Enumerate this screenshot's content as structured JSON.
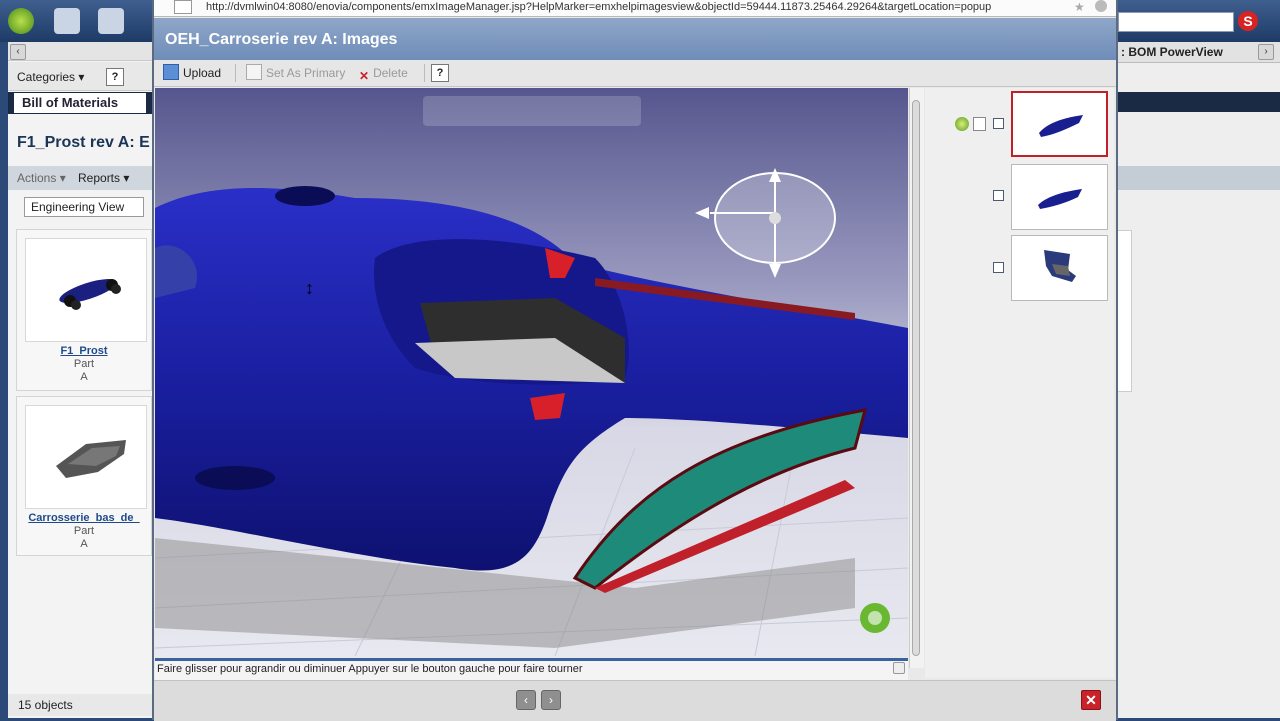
{
  "browser": {
    "url": "http://dvmlwin04:8080/enovia/components/emxImageManager.jsp?HelpMarker=emxhelpimagesview&objectId=59444.11873.25464.29264&targetLocation=popup"
  },
  "background_app": {
    "categories_label": "Categories",
    "help_label": "?",
    "tab_label": "Bill of Materials",
    "page_title": "F1_Prost rev A: E",
    "actions_label": "Actions",
    "reports_label": "Reports",
    "view_select": "Engineering View",
    "right_header": ": BOM PowerView",
    "cards": [
      {
        "name": "F1_Prost",
        "type": "Part",
        "rev": "A"
      },
      {
        "name": "Carrosserie_bas_de_",
        "type": "Part",
        "rev": "A"
      }
    ],
    "object_count": "15 objects"
  },
  "popup": {
    "title": "OEH_Carroserie rev A: Images",
    "toolbar": {
      "upload": "Upload",
      "set_primary": "Set As Primary",
      "delete": "Delete",
      "help": "?"
    },
    "status_text": "Faire glisser pour agrandir ou diminuer  Appuyer sur le bouton gauche pour faire tourner",
    "thumbnails": [
      {
        "selected": true,
        "icon": "f1-body-top-view"
      },
      {
        "selected": false,
        "icon": "f1-body-side-view"
      },
      {
        "selected": false,
        "icon": "f1-part-view"
      }
    ],
    "nav": {
      "prev": "‹",
      "next": "›",
      "close": "✕"
    }
  },
  "colors": {
    "title_bar": "#7d98c0",
    "car_body": "#1a1fa0",
    "accent_red": "#c0202a",
    "wing_teal": "#1d8a7a"
  }
}
